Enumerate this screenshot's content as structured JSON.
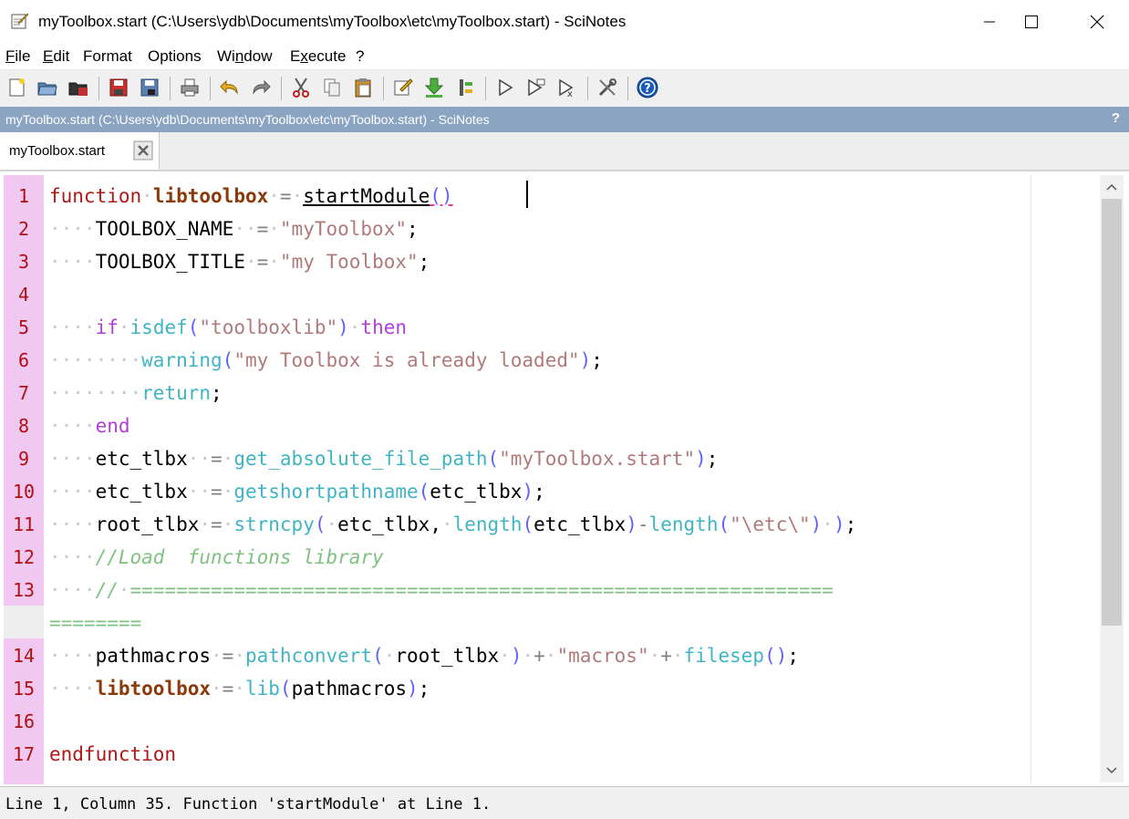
{
  "window": {
    "title": "myToolbox.start (C:\\Users\\ydb\\Documents\\myToolbox\\etc\\myToolbox.start) - SciNotes",
    "minimize_icon": "minimize-icon",
    "maximize_icon": "maximize-icon",
    "close_icon": "close-icon"
  },
  "menu": {
    "file": {
      "u": "F",
      "rest": "ile"
    },
    "edit": {
      "u": "E",
      "rest": "dit"
    },
    "format": "Format",
    "options": "Options",
    "window": {
      "pre": "Wi",
      "u": "n",
      "rest": "dow"
    },
    "execute": {
      "pre": "E",
      "u": "x",
      "rest": "ecute"
    },
    "help": "?"
  },
  "toolbar": {
    "icons": [
      "new-file-icon",
      "open-file-icon",
      "open-recent-icon",
      "save-icon",
      "save-as-icon",
      "print-icon",
      "undo-icon",
      "redo-icon",
      "cut-icon",
      "copy-icon",
      "paste-icon",
      "comment-icon",
      "load-icon",
      "execute-icon",
      "run-icon",
      "run-until-cursor-icon",
      "run-with-echo-icon",
      "settings-icon",
      "help-icon"
    ]
  },
  "docbar": {
    "title": "myToolbox.start (C:\\Users\\ydb\\Documents\\myToolbox\\etc\\myToolbox.start) - SciNotes",
    "help": "?"
  },
  "tab": {
    "label": "myToolbox.start"
  },
  "editor": {
    "line_numbers": [
      "1",
      "2",
      "3",
      "4",
      "5",
      "6",
      "7",
      "8",
      "9",
      "10",
      "11",
      "12",
      "13",
      "14",
      "15",
      "16",
      "17"
    ],
    "lines": {
      "l1": {
        "kw": "function",
        "name": "libtoolbox",
        "eq": "=",
        "fn": "startModule",
        "parens": "()"
      },
      "l2": {
        "ident": "TOOLBOX_NAME",
        "eq": "=",
        "str": "\"myToolbox\"",
        "end": ";"
      },
      "l3": {
        "ident": "TOOLBOX_TITLE",
        "eq": "=",
        "str": "\"my Toolbox\"",
        "end": ";"
      },
      "l5": {
        "kw_if": "if",
        "fn": "isdef",
        "open": "(",
        "str": "\"toolboxlib\"",
        "close": ")",
        "kw_then": "then"
      },
      "l6": {
        "fn": "warning",
        "open": "(",
        "str": "\"my Toolbox is already loaded\"",
        "close": ")",
        "end": ";"
      },
      "l7": {
        "kw": "return",
        "end": ";"
      },
      "l8": {
        "kw": "end"
      },
      "l9": {
        "ident": "etc_tlbx",
        "eq": "=",
        "fn": "get_absolute_file_path",
        "open": "(",
        "str": "\"myToolbox.start\"",
        "close": ")",
        "end": ";"
      },
      "l10": {
        "ident": "etc_tlbx",
        "eq": "=",
        "fn": "getshortpathname",
        "open": "(",
        "arg": "etc_tlbx",
        "close": ")",
        "end": ";"
      },
      "l11": {
        "ident": "root_tlbx",
        "eq": "=",
        "fn": "strncpy",
        "open": "(",
        "arg1": "etc_tlbx,",
        "fn2": "length",
        "arg2": "etc_tlbx",
        "minus": "-",
        "fn3": "length",
        "str": "\"\\etc\\\"",
        "end": ";"
      },
      "l12": {
        "comment": "//Load  functions library"
      },
      "l13": {
        "comment_start": "//",
        "equals": "=============================================================",
        "wrap": "========"
      },
      "l14": {
        "ident": "pathmacros",
        "eq": "=",
        "fn": "pathconvert",
        "open": "(",
        "arg": "root_tlbx",
        "close": ")",
        "plus": "+",
        "str": "\"macros\"",
        "fn2": "filesep",
        "parens": "()",
        "end": ";"
      },
      "l15": {
        "name": "libtoolbox",
        "eq": "=",
        "fn": "lib",
        "open": "(",
        "arg": "pathmacros",
        "close": ")",
        "end": ";"
      },
      "l17": {
        "kw": "endfunction"
      }
    }
  },
  "status": {
    "text": "Line 1, Column 35. Function 'startModule' at Line 1."
  }
}
